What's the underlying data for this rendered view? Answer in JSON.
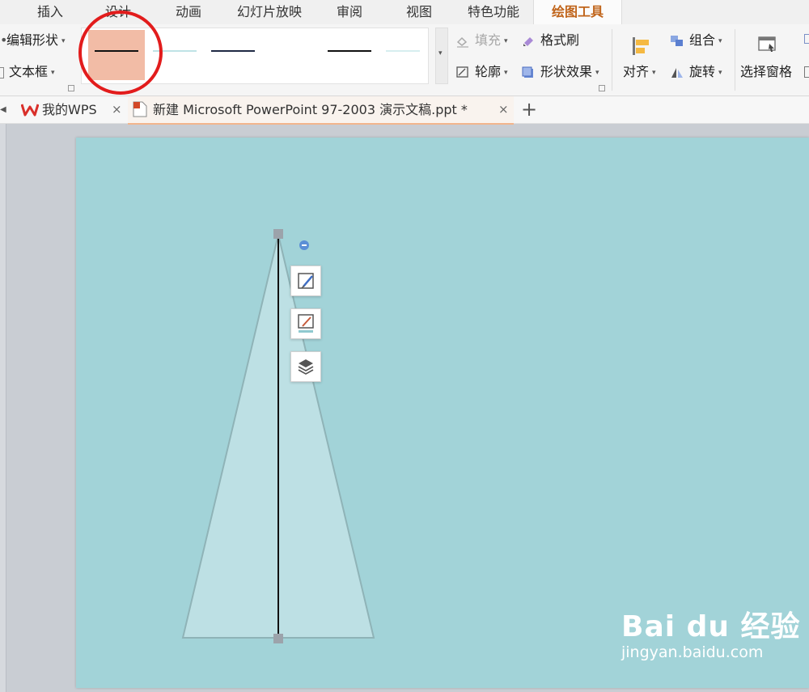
{
  "menu": {
    "tabs": [
      "插入",
      "设计",
      "动画",
      "幻灯片放映",
      "审阅",
      "视图",
      "特色功能",
      "绘图工具"
    ],
    "active_tab": "绘图工具"
  },
  "ribbon": {
    "edit_shape": "编辑形状",
    "text_box": "文本框",
    "fill": "填充",
    "format_painter": "格式刷",
    "outline": "轮廓",
    "shape_effects": "形状效果",
    "align": "对齐",
    "group": "组合",
    "rotate": "旋转",
    "selection_pane": "选择窗格",
    "dropdown_caret": "▾",
    "line_styles": [
      {
        "name": "style-1",
        "color": "#111111",
        "selected": true
      },
      {
        "name": "style-2",
        "color": "#bfe3e6",
        "selected": false
      },
      {
        "name": "style-3",
        "color": "#1f2a44",
        "selected": false
      },
      {
        "name": "style-4",
        "color": "#ffffff",
        "selected": false
      },
      {
        "name": "style-5",
        "color": "#111111",
        "selected": false
      },
      {
        "name": "style-6",
        "color": "#d6eeef",
        "selected": false
      }
    ],
    "selected_style_bg": "#f2bca6"
  },
  "doc_tabs": {
    "wps_home": "我的WPS",
    "document": "新建 Microsoft PowerPoint 97-2003 演示文稿.ppt *",
    "close_glyph": "×",
    "new_tab_glyph": "+"
  },
  "slide": {
    "background": "#a2d3d8",
    "triangle_fill": "#bde0e4",
    "triangle_stroke": "#8fb3b7",
    "line_color": "#111111"
  },
  "floating_toolbar": [
    "shape-style-icon",
    "shape-outline-icon",
    "layers-icon"
  ],
  "watermark": {
    "main": "Bai du 经验",
    "sub": "jingyan.baidu.com"
  },
  "annotation_color": "#e21c1c"
}
